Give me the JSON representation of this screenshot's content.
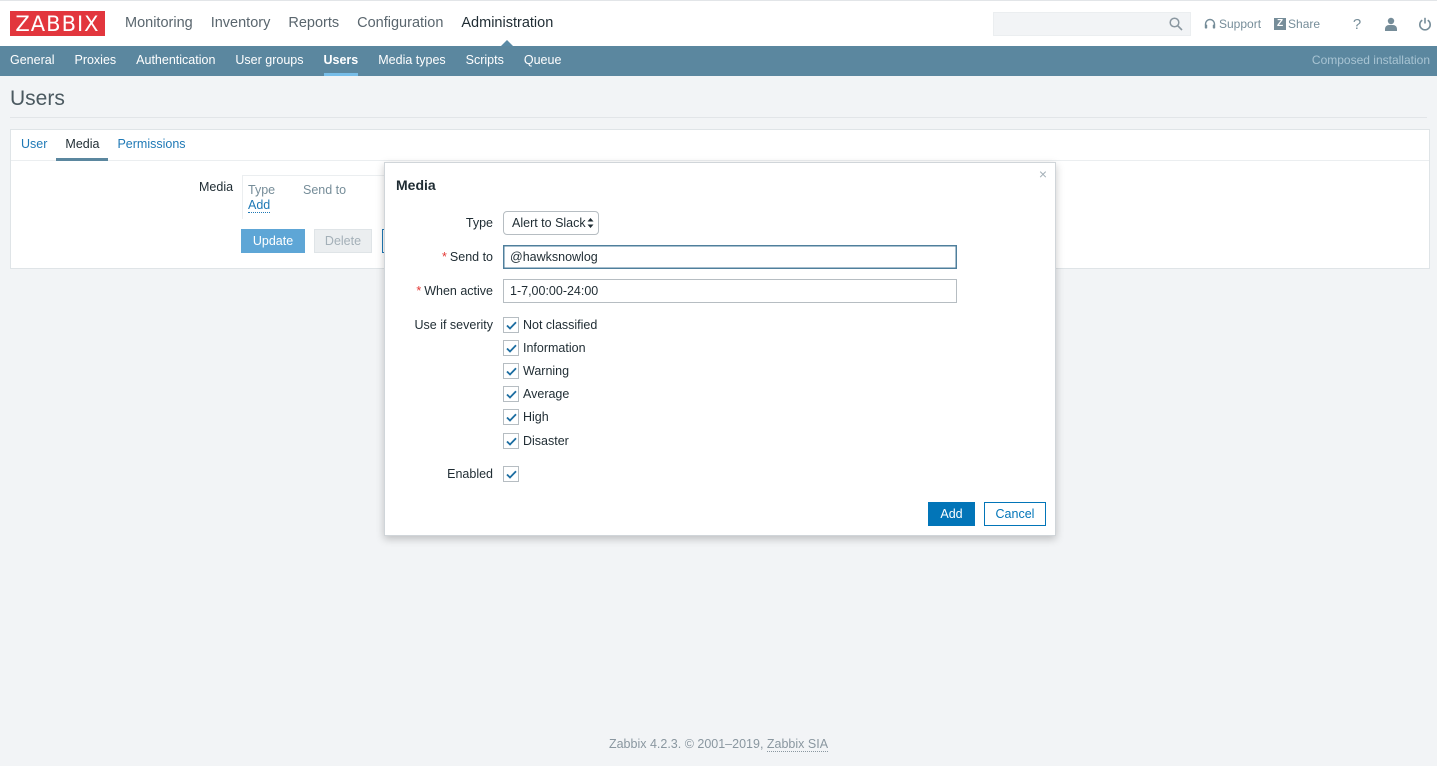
{
  "header": {
    "logo": "ZABBIX",
    "menu": [
      "Monitoring",
      "Inventory",
      "Reports",
      "Configuration",
      "Administration"
    ],
    "active_menu": "Administration",
    "search": {
      "value": "",
      "placeholder": ""
    },
    "support_label": "Support",
    "share_mark": "Z",
    "share_label": "Share",
    "help_label": "?"
  },
  "subnav": {
    "items": [
      "General",
      "Proxies",
      "Authentication",
      "User groups",
      "Users",
      "Media types",
      "Scripts",
      "Queue"
    ],
    "active": "Users",
    "installation": "Composed installation"
  },
  "page": {
    "title": "Users",
    "tabs": [
      "User",
      "Media",
      "Permissions"
    ],
    "active_tab": "Media",
    "media_label": "Media",
    "media_table": {
      "headers": [
        "Type",
        "Send to"
      ],
      "add_link": "Add"
    },
    "buttons": {
      "update": "Update",
      "delete": "Delete"
    }
  },
  "dialog": {
    "title": "Media",
    "close": "×",
    "type_label": "Type",
    "type_value": "Alert to Slack",
    "send_to_label": "Send to",
    "send_to_value": "@hawksnowlog",
    "when_active_label": "When active",
    "when_active_value": "1-7,00:00-24:00",
    "required_mark": "*",
    "severity_label": "Use if severity",
    "severities": [
      {
        "label": "Not classified",
        "checked": true
      },
      {
        "label": "Information",
        "checked": true
      },
      {
        "label": "Warning",
        "checked": true
      },
      {
        "label": "Average",
        "checked": true
      },
      {
        "label": "High",
        "checked": true
      },
      {
        "label": "Disaster",
        "checked": true
      }
    ],
    "enabled_label": "Enabled",
    "enabled": true,
    "add_button": "Add",
    "cancel_button": "Cancel"
  },
  "footer": {
    "text": "Zabbix 4.2.3. © 2001–2019, ",
    "link": "Zabbix SIA"
  },
  "colors": {
    "logo_red": "#e2363d",
    "subnav_blue": "#5b879f",
    "primary_button": "#0275b8",
    "link_blue": "#1f79b6"
  }
}
